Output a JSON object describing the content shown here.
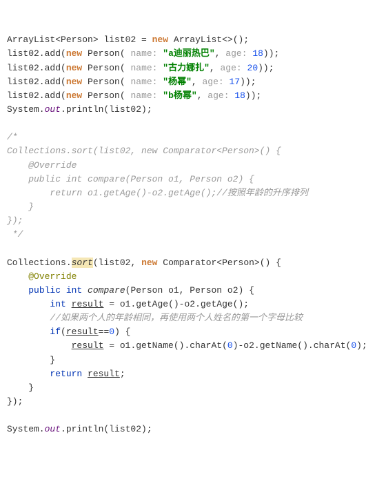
{
  "lines": {
    "l1": {
      "t1": "ArrayList",
      "t2": "<",
      "t3": "Person",
      "t4": "> list02 = ",
      "t5": "new ",
      "t6": "ArrayList",
      "t7": "<>();"
    },
    "l2": {
      "t1": "list02.add(",
      "t2": "new ",
      "t3": "Person",
      "t4": "( ",
      "p1": "name: ",
      "s1": "\"a迪丽热巴\"",
      "t5": ", ",
      "p2": "age: ",
      "n1": "18",
      "t6": "));"
    },
    "l3": {
      "t1": "list02.add(",
      "t2": "new ",
      "t3": "Person",
      "t4": "( ",
      "p1": "name: ",
      "s1": "\"古力娜扎\"",
      "t5": ", ",
      "p2": "age: ",
      "n1": "20",
      "t6": "));"
    },
    "l4": {
      "t1": "list02.add(",
      "t2": "new ",
      "t3": "Person",
      "t4": "( ",
      "p1": "name: ",
      "s1": "\"杨幂\"",
      "t5": ", ",
      "p2": "age: ",
      "n1": "17",
      "t6": "));"
    },
    "l5": {
      "t1": "list02.add(",
      "t2": "new ",
      "t3": "Person",
      "t4": "( ",
      "p1": "name: ",
      "s1": "\"b杨幂\"",
      "t5": ", ",
      "p2": "age: ",
      "n1": "18",
      "t6": "));"
    },
    "l6": {
      "t1": "System.",
      "t2": "out",
      "t3": ".println(list02);"
    },
    "c1": "/*",
    "c2": "Collections.sort(list02, new Comparator<Person>() {",
    "c3": "    @Override",
    "c4": "    public int compare(Person o1, Person o2) {",
    "c5": "        return o1.getAge()-o2.getAge();//按照年龄的升序排列",
    "c6": "    }",
    "c7": "});",
    "c8": " */",
    "s1": {
      "t1": "Collections.",
      "t2": "sort",
      "t3": "(list02, ",
      "t4": "new ",
      "t5": "Comparator",
      "t6": "<",
      "t7": "Person",
      "t8": ">() {"
    },
    "s2": {
      "t1": "@Override"
    },
    "s3": {
      "t1": "public ",
      "t2": "int ",
      "t3": "compare",
      "t4": "(",
      "t5": "Person ",
      "t6": "o1, ",
      "t7": "Person ",
      "t8": "o2) {"
    },
    "s4": {
      "t1": "int ",
      "t2": "result",
      "t3": " = o1.getAge()-o2.getAge();"
    },
    "s5": {
      "t1": "//如果两个人的年龄相同，再使用两个人姓名的第一个字母比较"
    },
    "s6": {
      "t1": "if",
      "t2": "(",
      "t3": "result",
      "t4": "==",
      "t5": "0",
      "t6": ") {"
    },
    "s7": {
      "t1": "result",
      "t2": " = o1.getName().charAt(",
      "t3": "0",
      "t4": ")-o2.getName().charAt(",
      "t5": "0",
      "t6": ");"
    },
    "s8": {
      "t1": "}"
    },
    "s9": {
      "t1": "return ",
      "t2": "result",
      "t3": ";"
    },
    "s10": {
      "t1": "}"
    },
    "s11": {
      "t1": "});"
    },
    "f1": {
      "t1": "System.",
      "t2": "out",
      "t3": ".println(list02);"
    }
  }
}
